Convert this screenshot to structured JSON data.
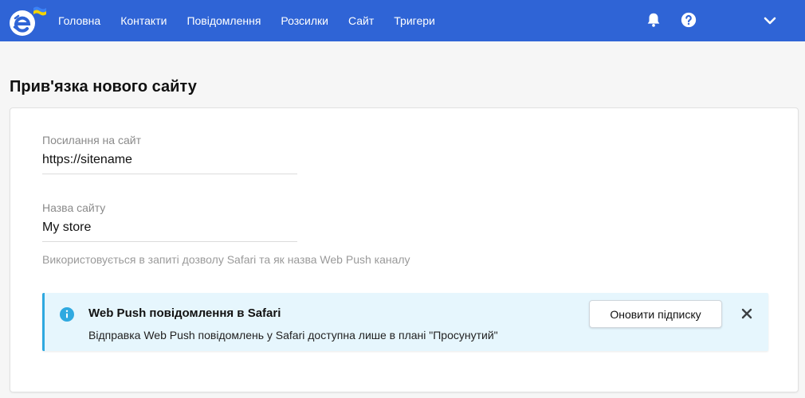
{
  "nav": {
    "items": [
      "Головна",
      "Контакти",
      "Повідомлення",
      "Розсилки",
      "Сайт",
      "Тригери"
    ]
  },
  "header_icons": {
    "bell": "bell-icon",
    "help": "help-icon",
    "dropdown": "chevron-down-icon"
  },
  "page": {
    "title": "Прив'язка нового сайту"
  },
  "form": {
    "site_url": {
      "label": "Посилання на сайт",
      "value": "https://sitename"
    },
    "site_name": {
      "label": "Назва сайту",
      "value": "My store"
    },
    "hint": "Використовується в запиті дозволу Safari та як назва Web Push каналу"
  },
  "alert": {
    "title": "Web Push повідомлення в Safari",
    "text": "Відправка Web Push повідомлень у Safari доступна лише в плані \"Просунутий\"",
    "button_label": "Оновити підписку"
  },
  "colors": {
    "topbar": "#2f64d6",
    "alert_bg": "#e6f6fd",
    "alert_accent": "#2fa9e0"
  }
}
